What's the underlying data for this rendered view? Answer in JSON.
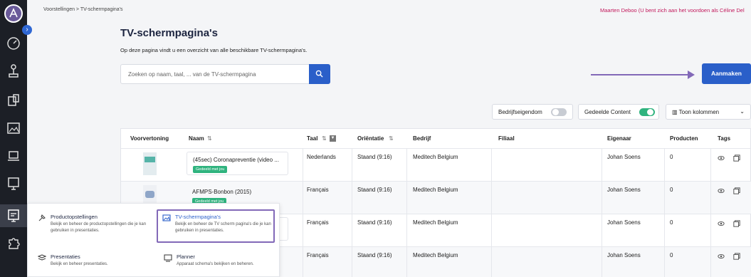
{
  "breadcrumb": "Voorstellingen > TV-schermpagina's",
  "warning": "Maarten Deboo (U bent zich aan het voordoen als Céline Del",
  "title": "TV-schermpagina's",
  "subtitle": "Op deze pagina vindt u een overzicht van alle beschikbare TV-schermpagina's.",
  "search_placeholder": "Zoeken op naam, taal, ... van de TV-schermpagina",
  "create_label": "Aanmaken",
  "filters": {
    "company": "Bedrijfseigendom",
    "shared": "Gedeelde Content",
    "columns": "Toon kolommen"
  },
  "columns": [
    "Voorvertoning",
    "Naam",
    "Taal",
    "Oriëntatie",
    "Bedrijf",
    "Filiaal",
    "Eigenaar",
    "Producten",
    "Tags"
  ],
  "rows": [
    {
      "name": "(45sec) Coronapreventie (video ...",
      "badge": "Gedeeld met jou",
      "lang": "Nederlands",
      "orient": "Staand (9:16)",
      "company": "Meditech Belgium",
      "owner": "Johan Soens",
      "products": "0"
    },
    {
      "name": "AFMPS-Bonbon (2015)",
      "badge": "Gedeeld met jou",
      "lang": "Français",
      "orient": "Staand (9:16)",
      "company": "Meditech Belgium",
      "owner": "Johan Soens",
      "products": "0"
    },
    {
      "name": "",
      "badge": "",
      "lang": "Français",
      "orient": "Staand (9:16)",
      "company": "Meditech Belgium",
      "owner": "Johan Soens",
      "products": "0"
    },
    {
      "name": "",
      "badge": "",
      "lang": "Français",
      "orient": "Staand (9:16)",
      "company": "Meditech Belgium",
      "owner": "Johan Soens",
      "products": "0"
    }
  ],
  "menu": {
    "items": [
      {
        "title": "Productopstellingen",
        "desc": "Bekijk en beheer de productopstellingen die je kan gebruiken in presentaties.",
        "icon": "pin-icon"
      },
      {
        "title": "TV-schermpagina's",
        "desc": "Bekijk en beheer de TV scherm pagina's die je kan gebruiken in presentaties.",
        "icon": "image-icon"
      },
      {
        "title": "Presentaties",
        "desc": "Bekijk en beheer presentaties.",
        "icon": "layers-icon"
      },
      {
        "title": "Planner",
        "desc": "Apparaat schema's bekijken en beheren.",
        "icon": "planner-icon"
      }
    ]
  },
  "colors": {
    "accent": "#2a5fc9",
    "toggle_on": "#2fb37e",
    "highlight": "#8269b8",
    "sidebar": "#1c1f26"
  }
}
